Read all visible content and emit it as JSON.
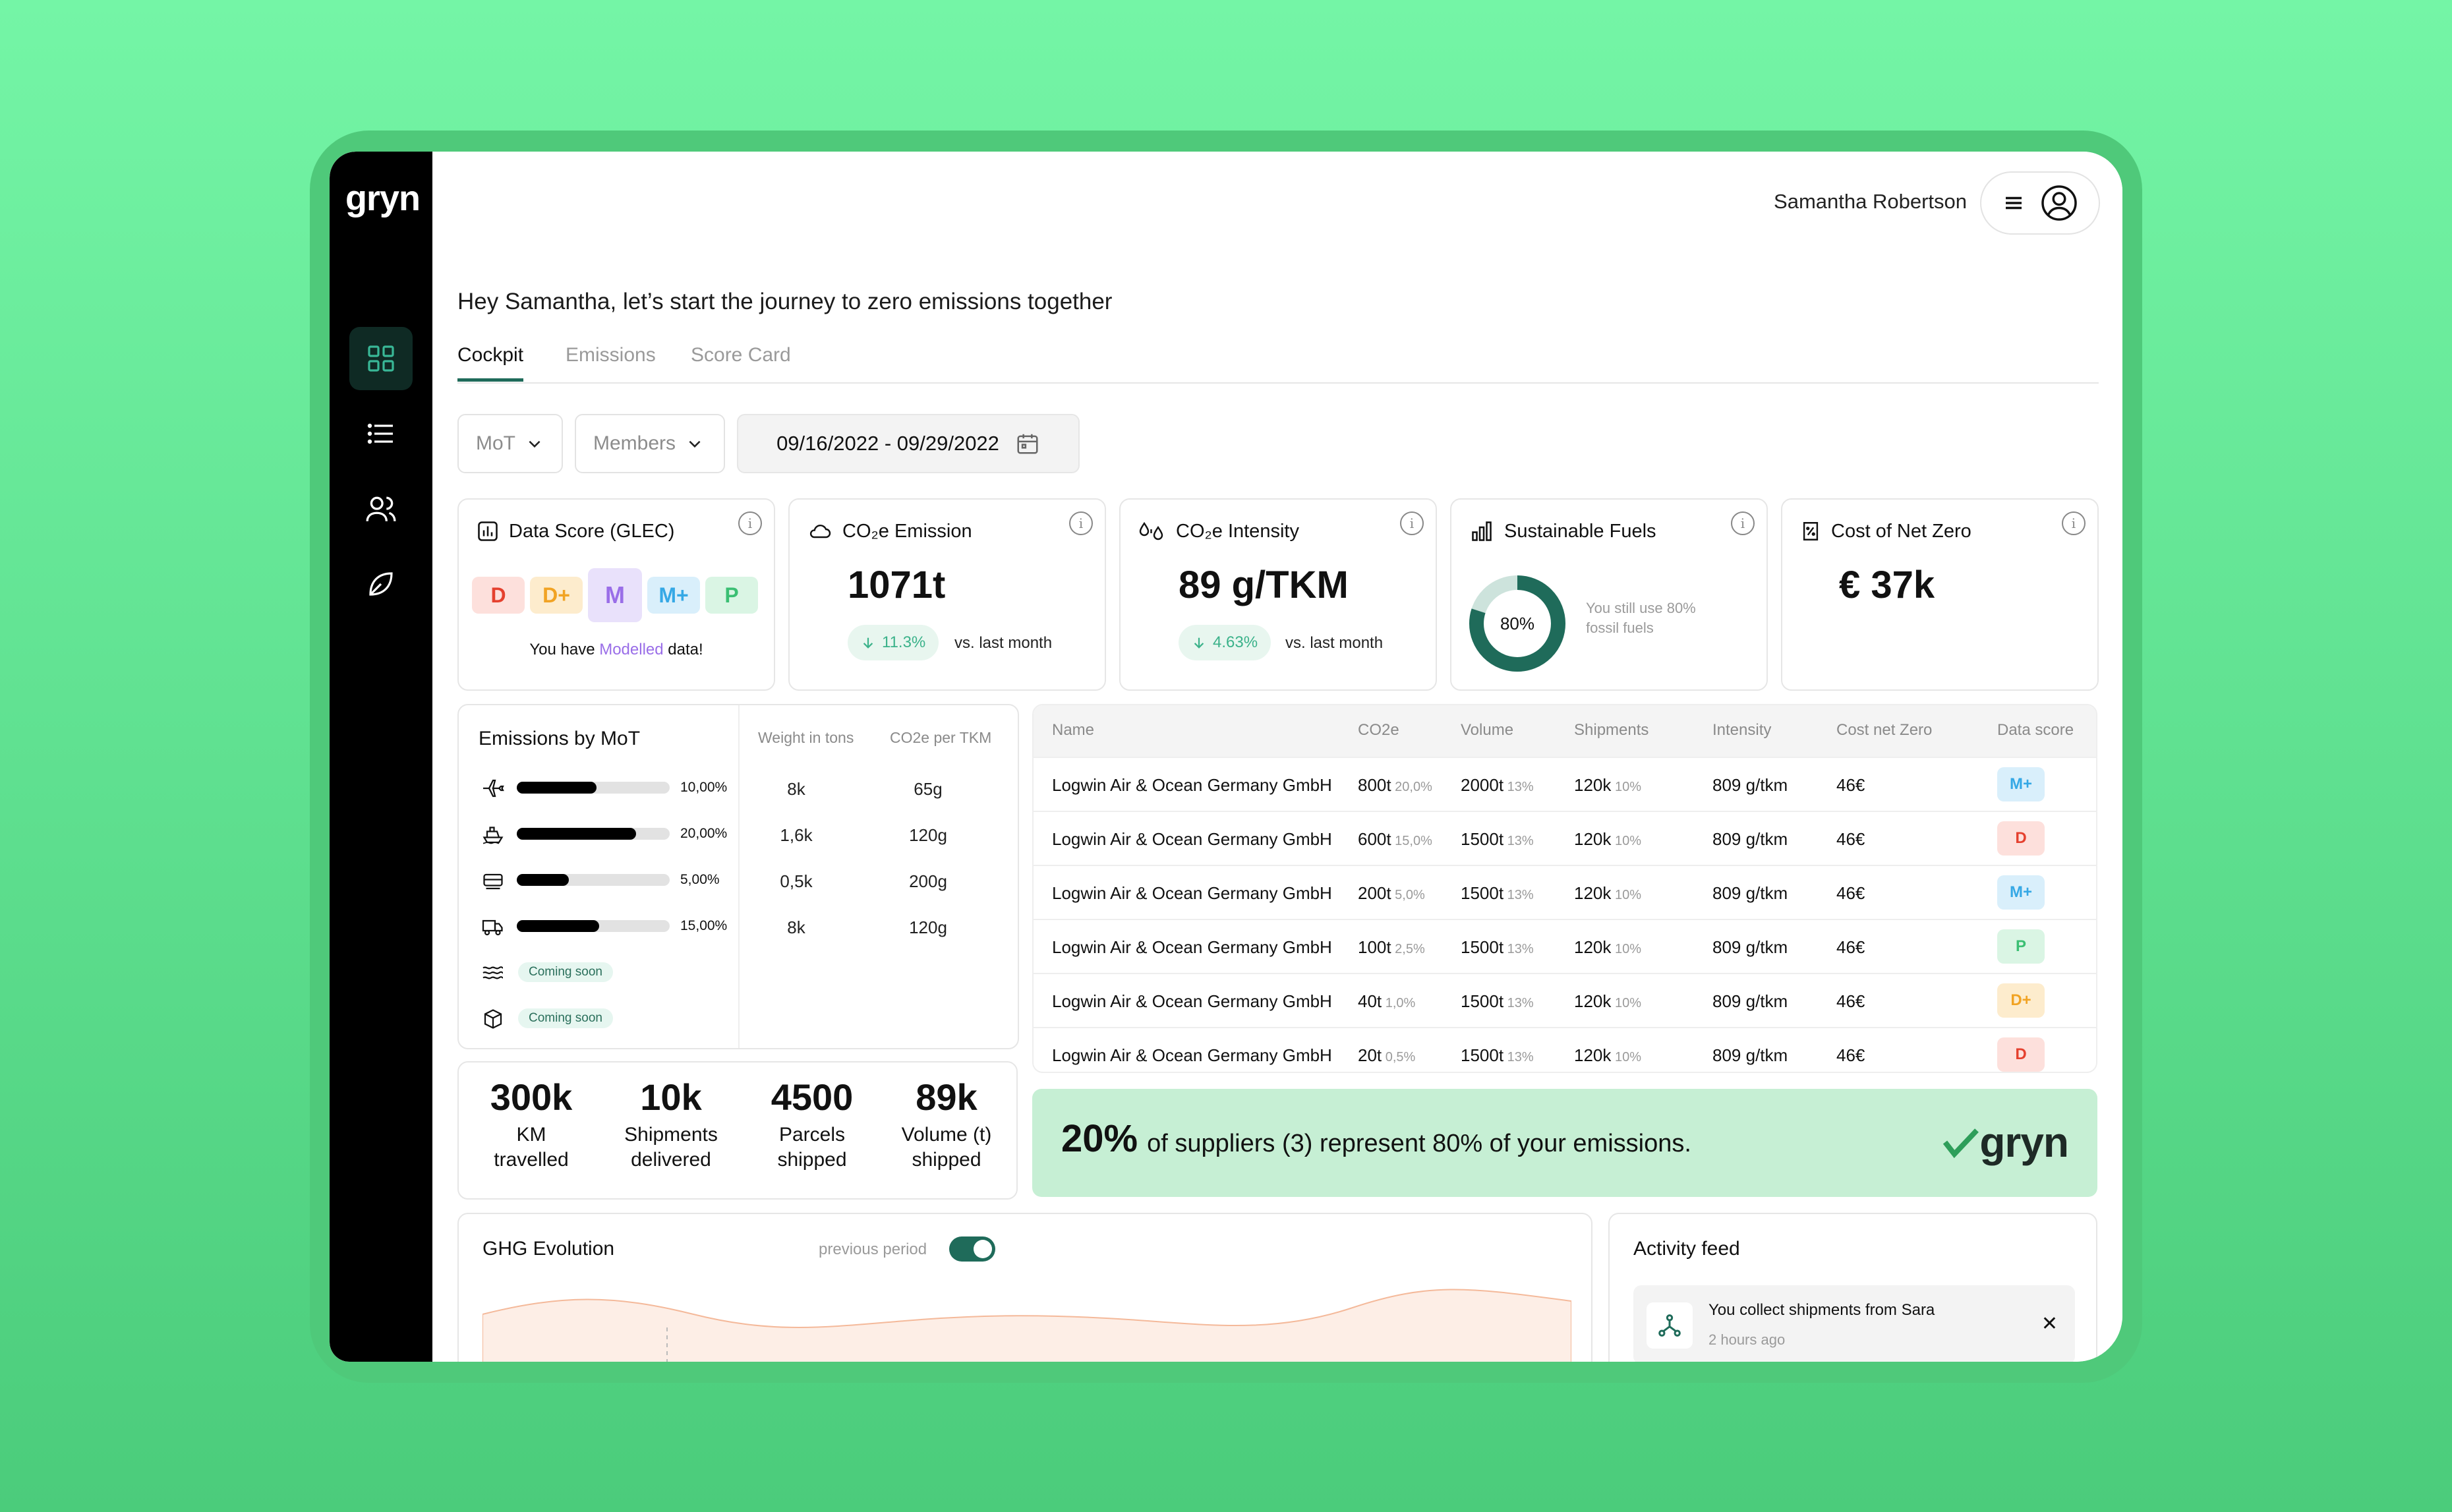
{
  "app": {
    "logo": "gryn"
  },
  "sidebar": {
    "items": [
      {
        "name": "dashboard",
        "icon": "grid-icon",
        "active": true
      },
      {
        "name": "list",
        "icon": "list-icon"
      },
      {
        "name": "members",
        "icon": "users-icon"
      },
      {
        "name": "sustainability",
        "icon": "leaf-icon"
      }
    ]
  },
  "header": {
    "user_name": "Samantha Robertson"
  },
  "greeting": "Hey Samantha, let’s start the journey to zero emissions together",
  "tabs": [
    "Cockpit",
    "Emissions",
    "Score Card"
  ],
  "filters": {
    "mot": "MoT",
    "members": "Members",
    "date_range": "09/16/2022 - 09/29/2022"
  },
  "cards": {
    "data_score": {
      "title": "Data Score (GLEC)",
      "scores": [
        "D",
        "D+",
        "M",
        "M+",
        "P"
      ],
      "selected": "M",
      "msg_pre": "You have ",
      "msg_highlight": "Modelled",
      "msg_post": " data!"
    },
    "co2_emission": {
      "title": "CO₂e Emission",
      "value": "1071t",
      "delta": "11.3%",
      "vs": "vs. last month"
    },
    "co2_intensity": {
      "title": "CO₂e Intensity",
      "value": "89 g/TKM",
      "delta": "4.63%",
      "vs": "vs. last month"
    },
    "sustainable_fuels": {
      "title": "Sustainable Fuels",
      "donut_label": "80%",
      "donut_value": 0.8,
      "note": "You still use 80% fossil fuels"
    },
    "cost_net_zero": {
      "title": "Cost of Net Zero",
      "value": "€ 37k"
    }
  },
  "emissions_by_mot": {
    "title": "Emissions by MoT",
    "col_weight": "Weight in tons",
    "col_co2": "CO2e per TKM",
    "rows": [
      {
        "icon": "plane-icon",
        "pct": "10,00%",
        "fill": 0.52,
        "weight": "8k",
        "co2": "65g"
      },
      {
        "icon": "ship-icon",
        "pct": "20,00%",
        "fill": 0.78,
        "weight": "1,6k",
        "co2": "120g"
      },
      {
        "icon": "train-icon",
        "pct": "5,00%",
        "fill": 0.34,
        "weight": "0,5k",
        "co2": "200g"
      },
      {
        "icon": "truck-icon",
        "pct": "15,00%",
        "fill": 0.54,
        "weight": "8k",
        "co2": "120g"
      },
      {
        "icon": "waves-icon",
        "soon": "Coming soon"
      },
      {
        "icon": "box-icon",
        "soon": "Coming soon"
      }
    ]
  },
  "table": {
    "headers": [
      "Name",
      "CO2e",
      "Volume",
      "Shipments",
      "Intensity",
      "Cost net Zero",
      "Data score"
    ],
    "rows": [
      {
        "name": "Logwin Air & Ocean Germany GmbH",
        "co2": "800t",
        "co2_pct": "20,0%",
        "volume": "2000t",
        "vol_pct": "13%",
        "shipments": "120k",
        "ship_pct": "10%",
        "intensity": "809 g/tkm",
        "cost": "46€",
        "score": "M+"
      },
      {
        "name": "Logwin Air & Ocean Germany GmbH",
        "co2": "600t",
        "co2_pct": "15,0%",
        "volume": "1500t",
        "vol_pct": "13%",
        "shipments": "120k",
        "ship_pct": "10%",
        "intensity": "809 g/tkm",
        "cost": "46€",
        "score": "D"
      },
      {
        "name": "Logwin Air & Ocean Germany GmbH",
        "co2": "200t",
        "co2_pct": "5,0%",
        "volume": "1500t",
        "vol_pct": "13%",
        "shipments": "120k",
        "ship_pct": "10%",
        "intensity": "809 g/tkm",
        "cost": "46€",
        "score": "M+"
      },
      {
        "name": "Logwin Air & Ocean Germany GmbH",
        "co2": "100t",
        "co2_pct": "2,5%",
        "volume": "1500t",
        "vol_pct": "13%",
        "shipments": "120k",
        "ship_pct": "10%",
        "intensity": "809 g/tkm",
        "cost": "46€",
        "score": "P"
      },
      {
        "name": "Logwin Air & Ocean Germany GmbH",
        "co2": "40t",
        "co2_pct": "1,0%",
        "volume": "1500t",
        "vol_pct": "13%",
        "shipments": "120k",
        "ship_pct": "10%",
        "intensity": "809 g/tkm",
        "cost": "46€",
        "score": "D+"
      },
      {
        "name": "Logwin Air & Ocean Germany GmbH",
        "co2": "20t",
        "co2_pct": "0,5%",
        "volume": "1500t",
        "vol_pct": "13%",
        "shipments": "120k",
        "ship_pct": "10%",
        "intensity": "809 g/tkm",
        "cost": "46€",
        "score": "D"
      }
    ]
  },
  "stats": [
    {
      "value": "300k",
      "label1": "KM",
      "label2": "travelled"
    },
    {
      "value": "10k",
      "label1": "Shipments",
      "label2": "delivered"
    },
    {
      "value": "4500",
      "label1": "Parcels",
      "label2": "shipped"
    },
    {
      "value": "89k",
      "label1": "Volume (t)",
      "label2": "shipped"
    }
  ],
  "banner": {
    "strong": "20%",
    "text": "of suppliers (3) represent 80% of your emissions.",
    "logo": "gryn"
  },
  "ghg": {
    "title": "GHG Evolution",
    "toggle_label": "previous period",
    "toggle_on": true
  },
  "activity": {
    "title": "Activity feed",
    "items": [
      {
        "text": "You collect shipments from Sara",
        "time": "2 hours ago"
      }
    ]
  },
  "score_colors": {
    "D": {
      "bg": "#fde0dc",
      "fg": "#e5412f"
    },
    "D+": {
      "bg": "#fdeccd",
      "fg": "#f1a323"
    },
    "M": {
      "bg": "#e9e1fb",
      "fg": "#9a6ee8"
    },
    "M+": {
      "bg": "#d9effb",
      "fg": "#35a8e5"
    },
    "P": {
      "bg": "#daf5e4",
      "fg": "#3bbf73"
    }
  }
}
